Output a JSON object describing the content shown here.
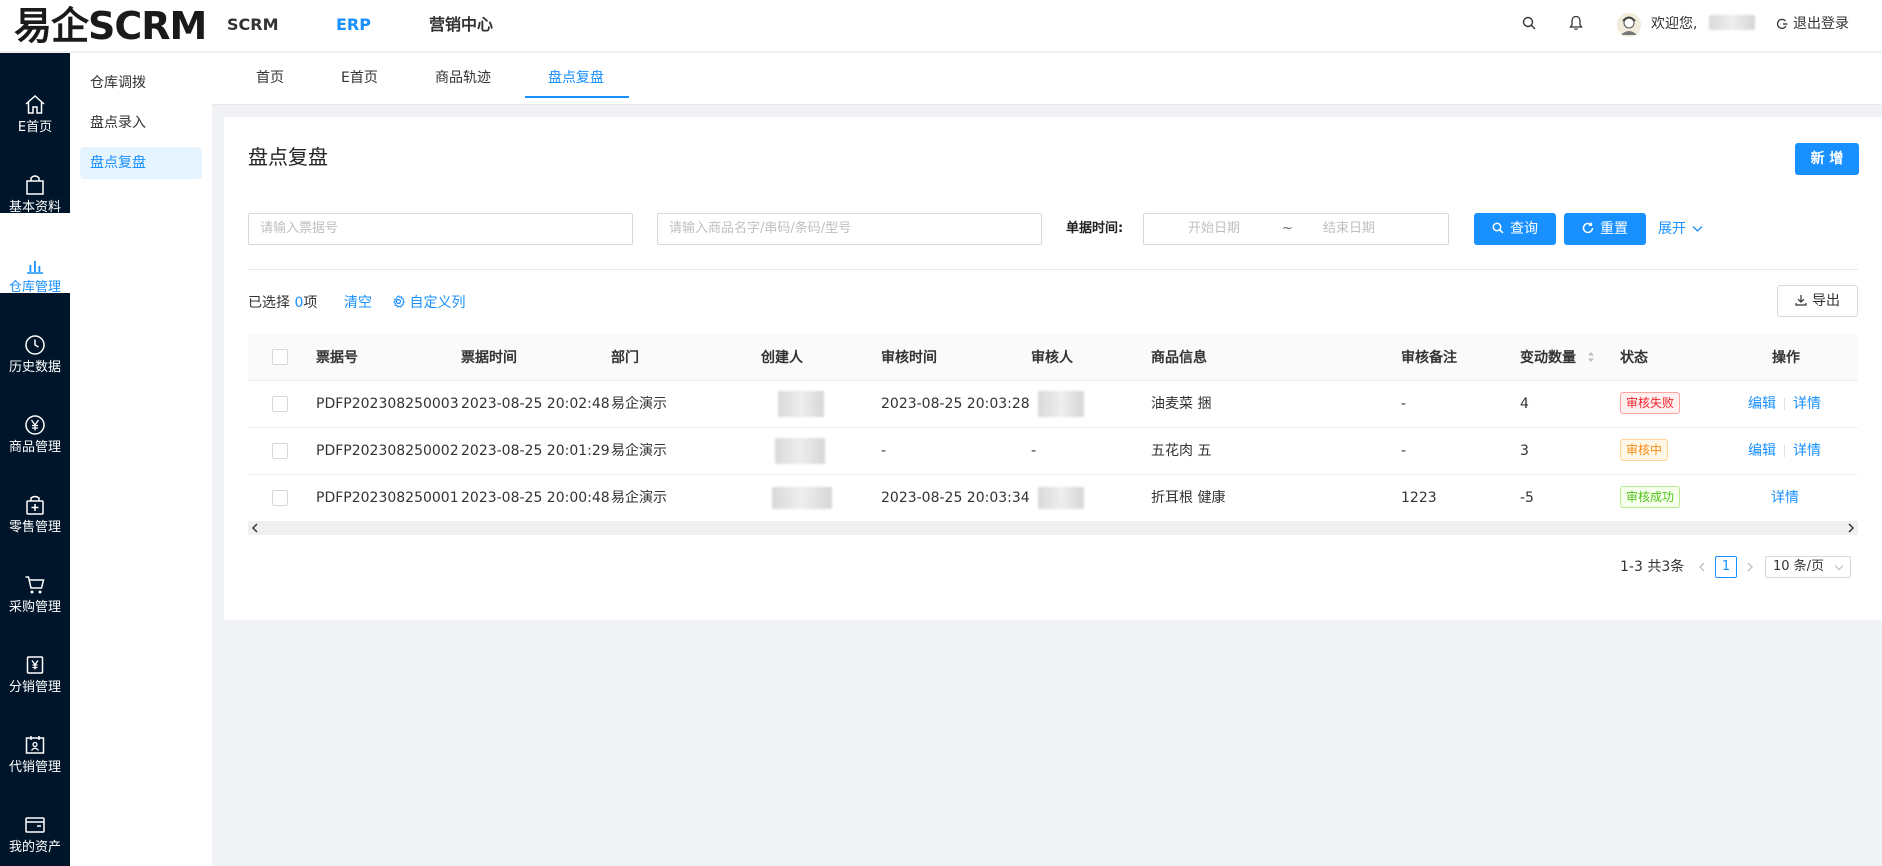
{
  "header": {
    "logo": "易企SCRM",
    "nav": [
      "SCRM",
      "ERP",
      "营销中心"
    ],
    "active_nav": "ERP",
    "welcome": "欢迎您,",
    "logout": "退出登录"
  },
  "sidebar": {
    "items": [
      {
        "label": "E首页",
        "icon": "home-icon"
      },
      {
        "label": "基本资料",
        "icon": "bag-icon"
      },
      {
        "label": "仓库管理",
        "icon": "bar-chart-icon",
        "active": true
      },
      {
        "label": "历史数据",
        "icon": "clock-icon"
      },
      {
        "label": "商品管理",
        "icon": "yen-circle-icon"
      },
      {
        "label": "零售管理",
        "icon": "shop-plus-icon"
      },
      {
        "label": "采购管理",
        "icon": "cart-icon"
      },
      {
        "label": "分销管理",
        "icon": "yen-bag-icon"
      },
      {
        "label": "代销管理",
        "icon": "calendar-person-icon"
      },
      {
        "label": "我的资产",
        "icon": "wallet-icon"
      }
    ]
  },
  "submenu": {
    "items": [
      "仓库调拨",
      "盘点录入",
      "盘点复盘"
    ],
    "active": "盘点复盘"
  },
  "tabs": {
    "items": [
      "首页",
      "E首页",
      "商品轨迹",
      "盘点复盘"
    ],
    "active": "盘点复盘"
  },
  "page": {
    "title": "盘点复盘",
    "new_button": "新 增"
  },
  "filters": {
    "ticket_placeholder": "请输入票据号",
    "product_placeholder": "请输入商品名字/串码/条码/型号",
    "date_label": "单据时间:",
    "start_date_placeholder": "开始日期",
    "date_separator": "~",
    "end_date_placeholder": "结束日期",
    "query_button": "查询",
    "reset_button": "重置",
    "expand": "展开"
  },
  "selection": {
    "prefix": "已选择",
    "count": "0",
    "suffix": "项",
    "clear": "清空",
    "custom_columns": "自定义列",
    "export": "导出"
  },
  "table": {
    "columns": [
      "票据号",
      "票据时间",
      "部门",
      "创建人",
      "审核时间",
      "审核人",
      "商品信息",
      "审核备注",
      "变动数量",
      "状态",
      "操作"
    ],
    "rows": [
      {
        "ticket": "PDFP202308250003",
        "time": "2023-08-25 20:02:48",
        "dept": "易企演示",
        "audit_time": "2023-08-25 20:03:28",
        "auditor_blurred": true,
        "product": "油麦菜 捆",
        "remark": "-",
        "qty": "4",
        "status": "审核失败",
        "status_color": "#f5222d",
        "actions": [
          "编辑",
          "详情"
        ]
      },
      {
        "ticket": "PDFP202308250002",
        "time": "2023-08-25 20:01:29",
        "dept": "易企演示",
        "audit_time": "-",
        "auditor": "-",
        "product": "五花肉 五",
        "remark": "-",
        "qty": "3",
        "status": "审核中",
        "status_color": "#fa8c16",
        "actions": [
          "编辑",
          "详情"
        ]
      },
      {
        "ticket": "PDFP202308250001",
        "time": "2023-08-25 20:00:48",
        "dept": "易企演示",
        "audit_time": "2023-08-25 20:03:34",
        "auditor_blurred": true,
        "product": "折耳根 健康",
        "remark": "1223",
        "qty": "-5",
        "status": "审核成功",
        "status_color": "#52c41a",
        "actions": [
          "详情"
        ]
      }
    ]
  },
  "pagination": {
    "summary": "1-3 共3条",
    "current_page": "1",
    "page_size": "10 条/页"
  },
  "colors": {
    "primary": "#1890ff",
    "sidebar_bg": "#001529"
  }
}
